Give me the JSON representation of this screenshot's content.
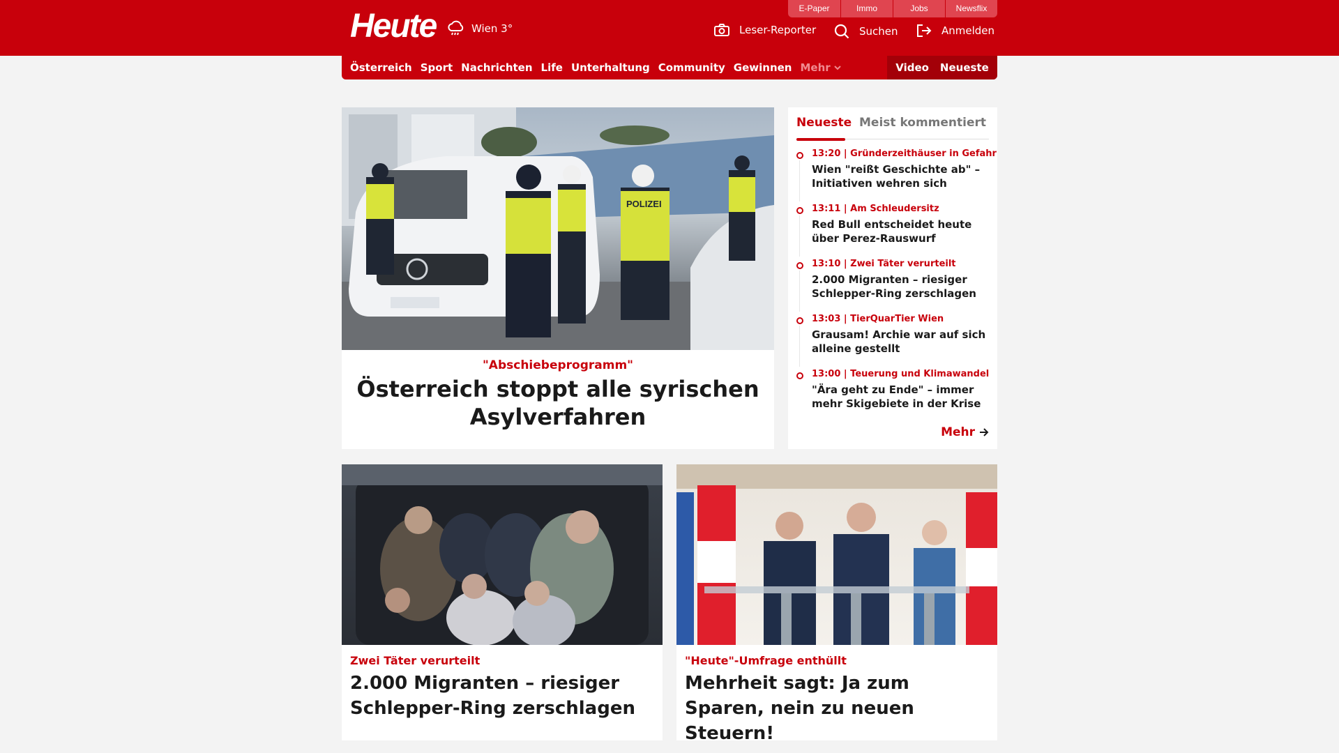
{
  "header": {
    "logo": "Heute",
    "weather": "Wien 3°",
    "utility_links": [
      "E-Paper",
      "Immo",
      "Jobs",
      "Newsflix"
    ],
    "reporter": "Leser-Reporter",
    "search": "Suchen",
    "login": "Anmelden"
  },
  "nav": {
    "items": [
      "Österreich",
      "Sport",
      "Nachrichten",
      "Life",
      "Unterhaltung",
      "Community",
      "Gewinnen"
    ],
    "more": "Mehr",
    "video": "Video",
    "latest": "Neueste"
  },
  "hero": {
    "kicker": "\"Abschiebeprogramm\"",
    "title": "Österreich stoppt alle syrischen Asylverfahren",
    "image_sign": "POLIZEI"
  },
  "sidebar": {
    "tab_latest": "Neueste",
    "tab_comments": "Meist kommentiert",
    "items": [
      {
        "kicker": "13:20 | Gründerzeithäuser in Gefahr",
        "title": "Wien \"reißt Geschichte ab\" – Initiativen wehren sich"
      },
      {
        "kicker": "13:11 | Am Schleudersitz",
        "title": "Red Bull entscheidet heute über Perez-Rauswurf"
      },
      {
        "kicker": "13:10 | Zwei Täter verurteilt",
        "title": "2.000 Migranten – riesiger Schlepper-Ring zerschlagen"
      },
      {
        "kicker": "13:03 | TierQuarTier Wien",
        "title": "Grausam! Archie war auf sich alleine gestellt"
      },
      {
        "kicker": "13:00 | Teuerung und Klimawandel",
        "title": "\"Ära geht zu Ende\" – immer mehr Skigebiete in der Krise"
      }
    ],
    "more": "Mehr"
  },
  "cards": [
    {
      "kicker": "Zwei Täter verurteilt",
      "title": "2.000 Migranten – riesiger Schlepper-Ring zerschlagen"
    },
    {
      "kicker": "\"Heute\"-Umfrage enthüllt",
      "title": "Mehrheit sagt: Ja zum Sparen, nein zu neuen Steuern!"
    }
  ],
  "colors": {
    "brand": "#c8000b",
    "background": "#f3f3f3"
  }
}
